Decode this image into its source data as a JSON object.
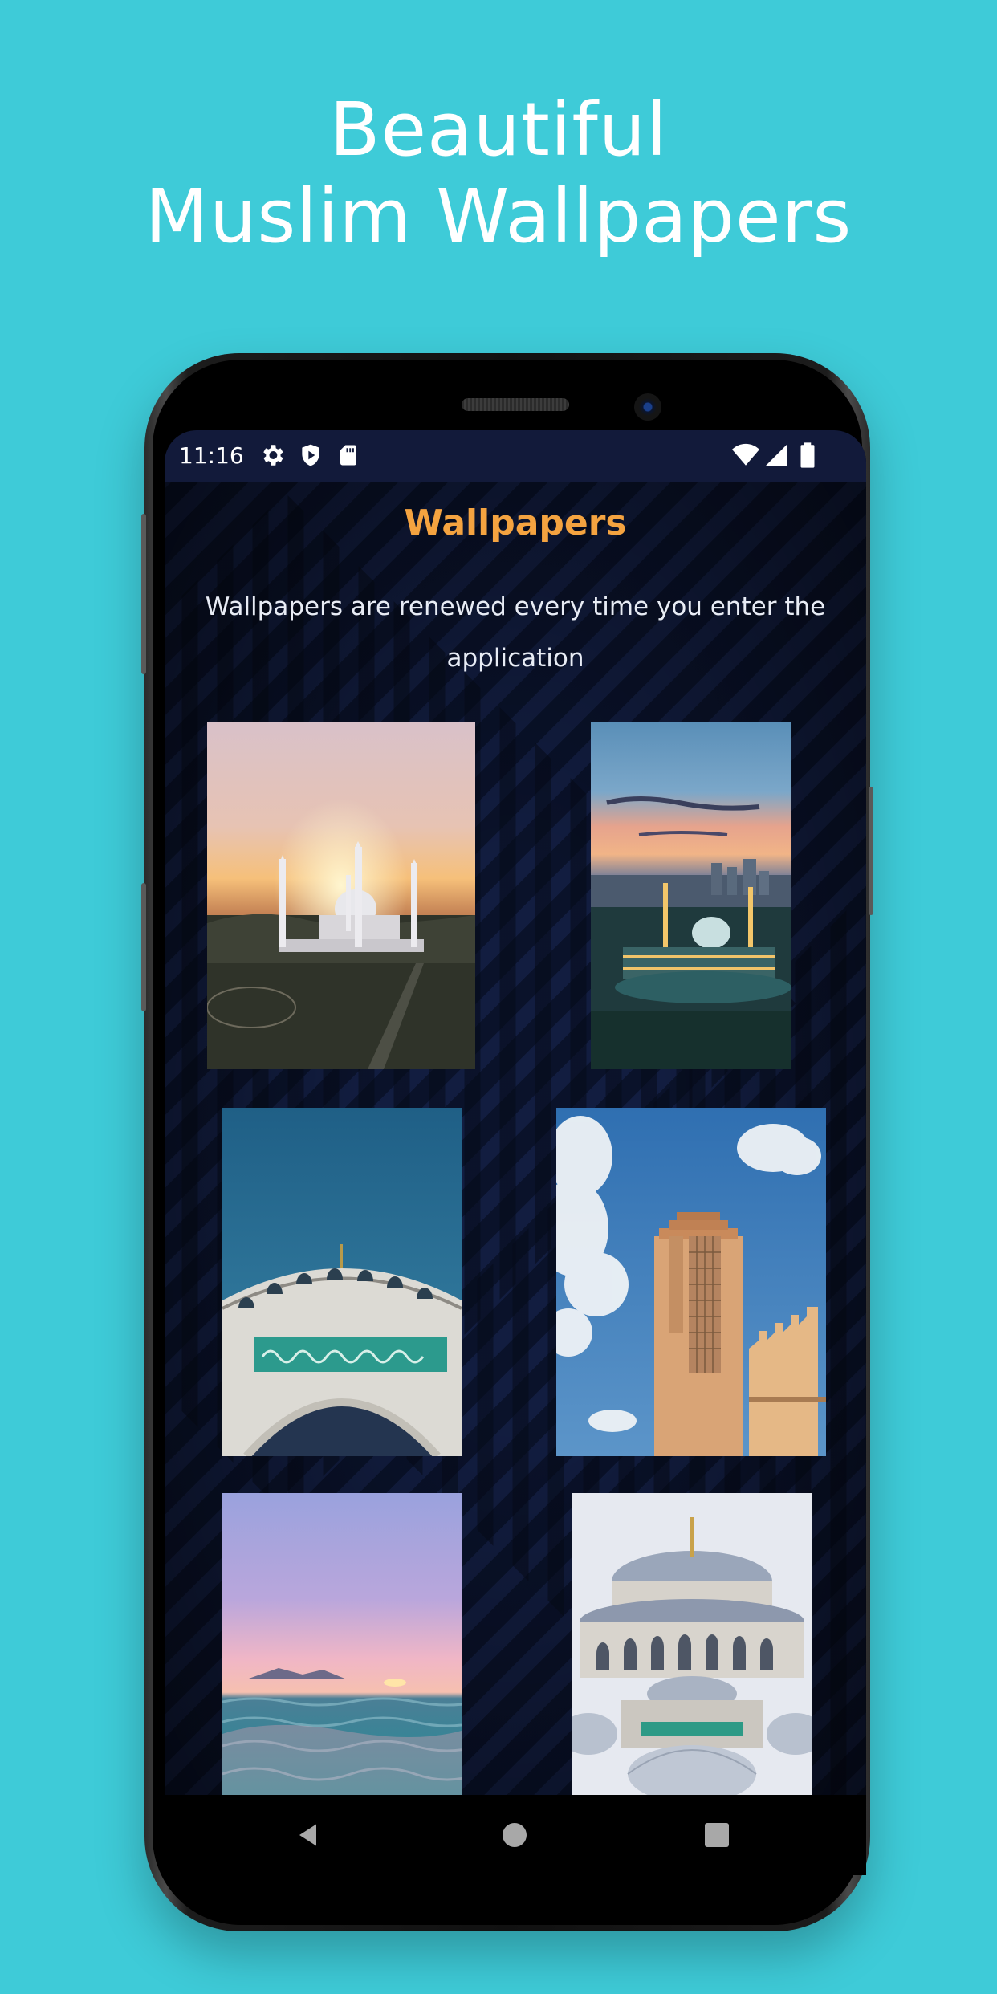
{
  "promo": {
    "title_line1": "Beautiful",
    "title_line2": "Muslim Wallpapers",
    "background_color": "#3ecbd8"
  },
  "status_bar": {
    "time": "11:16",
    "left_icons": [
      "gear-icon",
      "play-protect-icon",
      "sd-card-icon"
    ],
    "right_icons": [
      "wifi-icon",
      "cell-signal-icon",
      "battery-icon"
    ]
  },
  "app": {
    "title": "Wallpapers",
    "title_color": "#f4a340",
    "subtitle": "Wallpapers are renewed every time you enter the application"
  },
  "wallpapers": [
    {
      "scene": "mosque at sunset with minarets"
    },
    {
      "scene": "illuminated mosque at dusk with city skyline"
    },
    {
      "scene": "mosque arch with green calligraphy"
    },
    {
      "scene": "minaret tower with cloudy blue sky"
    },
    {
      "scene": "ocean horizon at sunset"
    },
    {
      "scene": "Blue Mosque domes"
    }
  ],
  "navigation": {
    "buttons": [
      "back-icon",
      "home-icon",
      "recents-icon"
    ]
  }
}
